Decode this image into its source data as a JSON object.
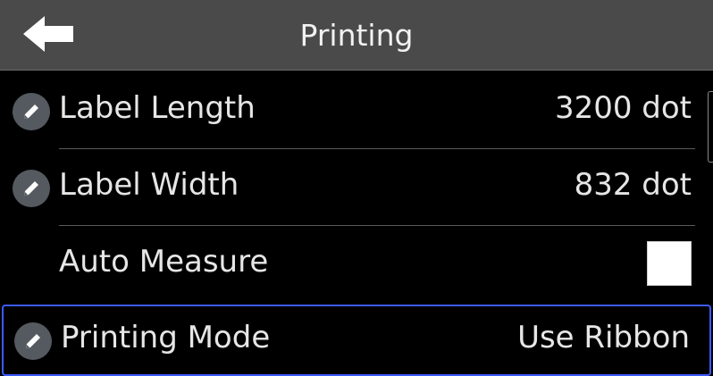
{
  "header": {
    "title": "Printing",
    "back_icon": "arrow-left-icon"
  },
  "rows": [
    {
      "label": "Label Length",
      "value": "3200 dot",
      "icon": "pencil-icon",
      "type": "value"
    },
    {
      "label": "Label Width",
      "value": "832 dot",
      "icon": "pencil-icon",
      "type": "value"
    },
    {
      "label": "Auto Measure",
      "checked": false,
      "type": "checkbox"
    },
    {
      "label": "Printing Mode",
      "value": "Use Ribbon",
      "icon": "pencil-icon",
      "type": "value",
      "selected": true
    }
  ],
  "colors": {
    "header_bg": "#4a4a4a",
    "background": "#000000",
    "selection_border": "#3d5bff",
    "icon_bg": "#555a60"
  }
}
